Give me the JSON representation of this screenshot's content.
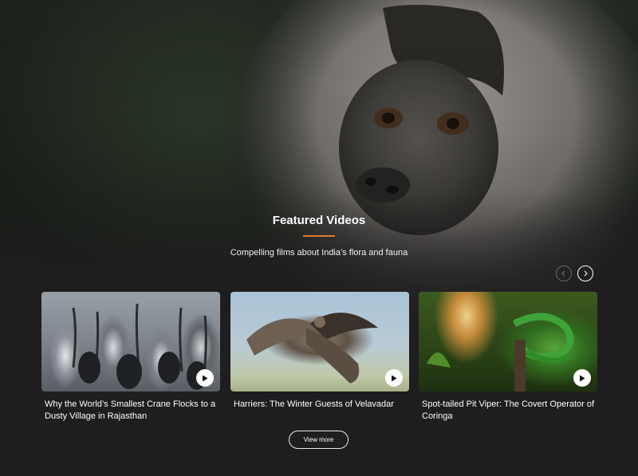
{
  "section": {
    "title": "Featured Videos",
    "subtitle": "Compelling films about India’s flora and fauna",
    "accent_color": "#e07a2a"
  },
  "carousel": {
    "prev_icon": "chevron-left-icon",
    "next_icon": "chevron-right-icon"
  },
  "videos": [
    {
      "title": "Why the World’s Smallest Crane Flocks to a Dusty Village in Rajasthan",
      "icon": "play-icon"
    },
    {
      "title": "Harriers: The Winter Guests of Velavadar",
      "icon": "play-icon"
    },
    {
      "title": "Spot-tailed Pit Viper: The Covert Operator of Coringa",
      "icon": "play-icon"
    }
  ],
  "view_more_label": "View more"
}
